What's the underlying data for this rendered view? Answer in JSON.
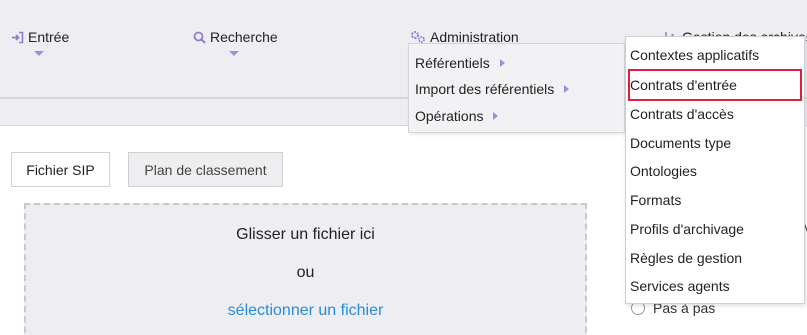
{
  "nav": {
    "entree": "Entrée",
    "recherche": "Recherche",
    "administration": "Administration",
    "gestion": "Gestion des archives"
  },
  "icons": {
    "entree": "login-arrow-icon",
    "recherche": "search-icon",
    "administration": "gears-icon",
    "gestion": "chart-icon"
  },
  "tabs": {
    "fichier_sip": "Fichier SIP",
    "plan_classement": "Plan de classement"
  },
  "dropzone": {
    "line1": "Glisser un fichier ici",
    "line2": "ou",
    "link": "sélectionner un fichier"
  },
  "side": {
    "m_label": "M",
    "radio_label": "Pas à pas"
  },
  "admin_menu": {
    "items": [
      "Référentiels",
      "Import des référentiels",
      "Opérations"
    ]
  },
  "submenu": {
    "items": [
      "Contextes applicatifs",
      "Contrats d'entrée",
      "Contrats d'accès",
      "Documents type",
      "Ontologies",
      "Formats",
      "Profils d'archivage",
      "Règles de gestion",
      "Services agents"
    ],
    "highlighted_index": 1
  },
  "colors": {
    "accent": "#9a8fe0",
    "link": "#2a8ad8",
    "highlight_border": "#e0203a",
    "band": "#eeeef2"
  }
}
